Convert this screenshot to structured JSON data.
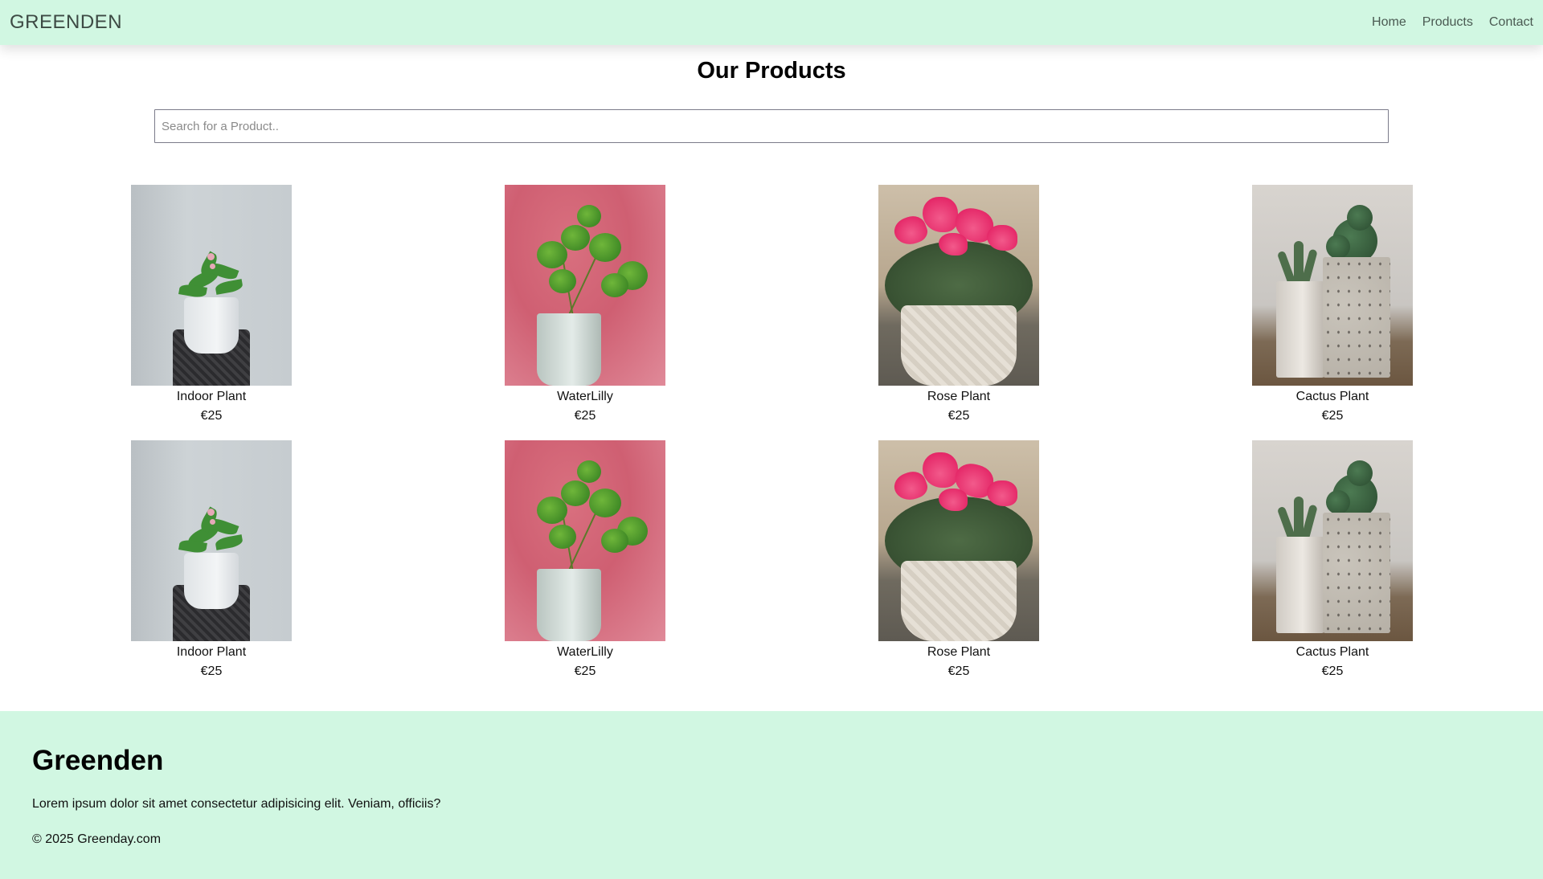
{
  "navbar": {
    "brand": "GREENDEN",
    "links": [
      "Home",
      "Products",
      "Contact"
    ]
  },
  "page_title": "Our Products",
  "search": {
    "placeholder": "Search for a Product..",
    "value": ""
  },
  "products": [
    {
      "name": "Indoor Plant",
      "price": "€25",
      "image": "indoor-plant"
    },
    {
      "name": "WaterLilly",
      "price": "€25",
      "image": "waterlilly"
    },
    {
      "name": "Rose Plant",
      "price": "€25",
      "image": "rose-plant"
    },
    {
      "name": "Cactus Plant",
      "price": "€25",
      "image": "cactus-plant"
    },
    {
      "name": "Indoor Plant",
      "price": "€25",
      "image": "indoor-plant"
    },
    {
      "name": "WaterLilly",
      "price": "€25",
      "image": "waterlilly"
    },
    {
      "name": "Rose Plant",
      "price": "€25",
      "image": "rose-plant"
    },
    {
      "name": "Cactus Plant",
      "price": "€25",
      "image": "cactus-plant"
    }
  ],
  "footer": {
    "title": "Greenden",
    "text": "Lorem ipsum dolor sit amet consectetur adipisicing elit. Veniam, officiis?",
    "copyright": "© 2025 Greenday.com"
  },
  "colors": {
    "navbar_bg": "#d1f7e2",
    "footer_bg": "#d1f7e2"
  }
}
